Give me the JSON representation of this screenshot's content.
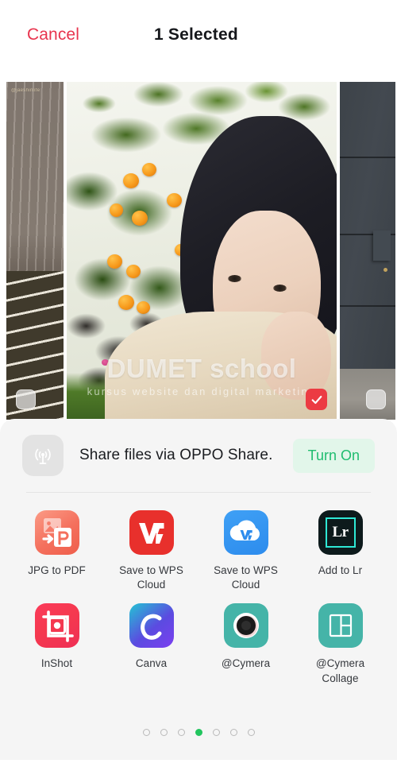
{
  "header": {
    "cancel_label": "Cancel",
    "title": "1 Selected"
  },
  "photos": {
    "left": {
      "name": "photo-thumbnail-left",
      "selected": false,
      "corner_tag": "@jaeshinlife"
    },
    "main": {
      "name": "photo-thumbnail-main",
      "selected": true,
      "watermark_title": "DUMET school",
      "watermark_subtitle": "kursus website dan digital marketing"
    },
    "right": {
      "name": "photo-thumbnail-right",
      "selected": false
    }
  },
  "oppo_share": {
    "icon": "broadcast-icon",
    "text": "Share files via OPPO Share.",
    "button_label": "Turn On",
    "button_bg": "#e2f6ea",
    "button_color": "#20bd70"
  },
  "apps": [
    {
      "label": "JPG to PDF",
      "icon": "jpg-to-pdf-icon",
      "color": "#f4705d"
    },
    {
      "label": "Save to WPS Cloud",
      "icon": "wps-office-icon",
      "color": "#e8302c"
    },
    {
      "label": "Save to WPS Cloud",
      "icon": "wps-cloud-icon",
      "color": "#2d8ced"
    },
    {
      "label": "Add to Lr",
      "icon": "lightroom-icon",
      "color": "#0d1a1c"
    },
    {
      "label": "InShot",
      "icon": "inshot-icon",
      "color": "#f5394f"
    },
    {
      "label": "Canva",
      "icon": "canva-icon",
      "color": "#7b3ff0"
    },
    {
      "label": "@Cymera",
      "icon": "cymera-camera-icon",
      "color": "#45b4a8"
    },
    {
      "label": "@Cymera Collage",
      "icon": "cymera-collage-icon",
      "color": "#45b4a8"
    }
  ],
  "pagination": {
    "total": 7,
    "active_index": 3,
    "active_color": "#22c55e"
  },
  "colors": {
    "cancel": "#E8344E",
    "sheet_bg": "#f5f5f5",
    "selected_badge": "#EC3B43"
  }
}
